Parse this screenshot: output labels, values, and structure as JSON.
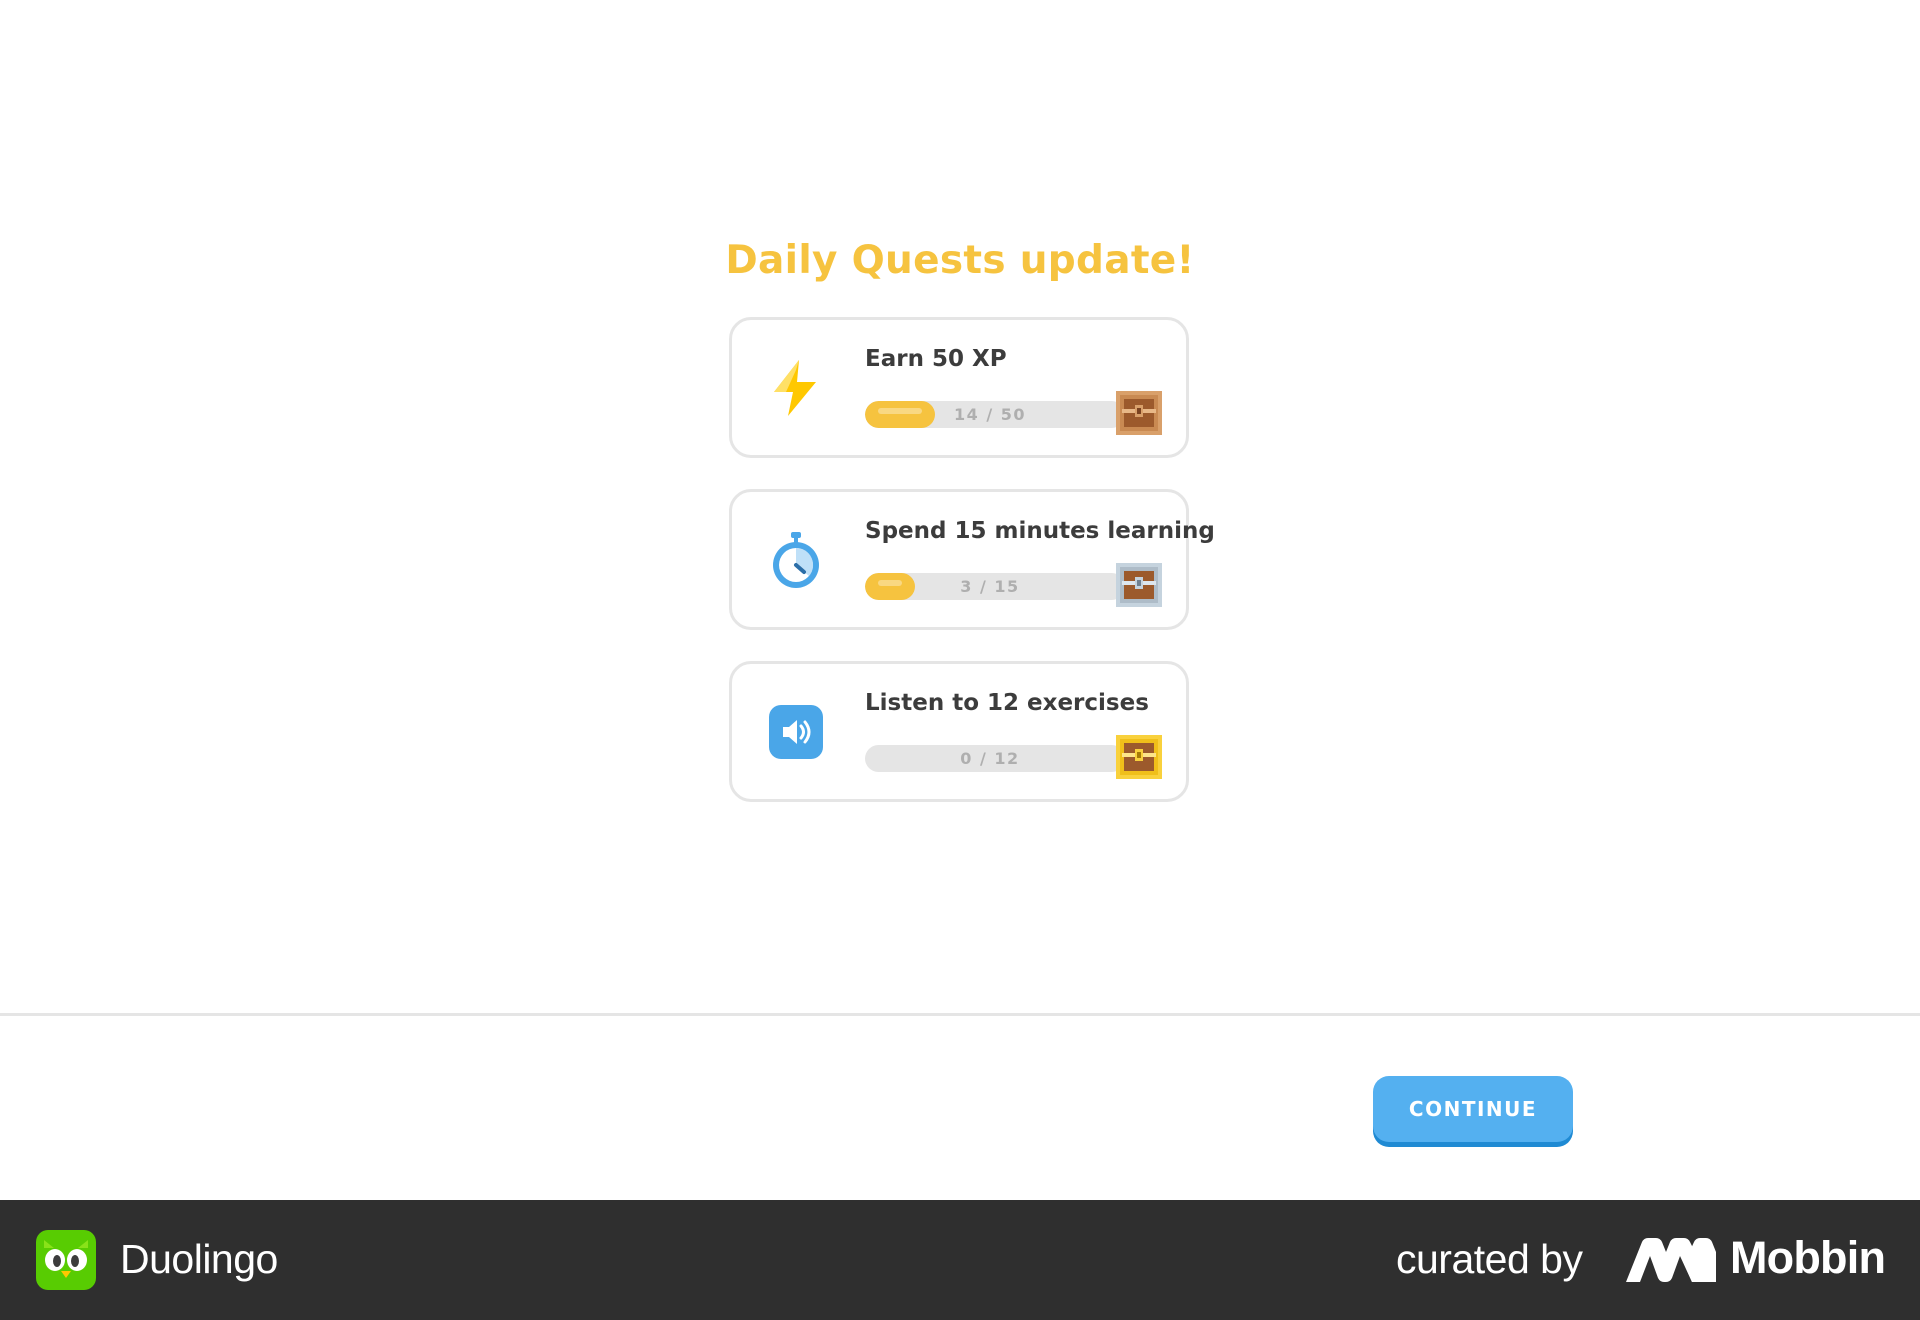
{
  "header": {
    "title": "Daily Quests update!"
  },
  "quests": [
    {
      "title": "Earn 50 XP",
      "icon": "lightning-bolt-icon",
      "current": 14,
      "target": 50,
      "progress_text": "14 / 50",
      "reward": "wooden-chest-icon"
    },
    {
      "title": "Spend 15 minutes learning",
      "icon": "stopwatch-icon",
      "current": 3,
      "target": 15,
      "progress_text": "3 / 15",
      "reward": "silver-chest-icon"
    },
    {
      "title": "Listen to 12 exercises",
      "icon": "speaker-icon",
      "current": 0,
      "target": 12,
      "progress_text": "0 / 12",
      "reward": "gold-chest-icon"
    }
  ],
  "actions": {
    "continue_label": "CONTINUE"
  },
  "footer": {
    "app_name": "Duolingo",
    "curated_label": "curated by",
    "curator_name": "Mobbin"
  },
  "colors": {
    "title_yellow": "#f6c33f",
    "progress_fill": "#f6c33f",
    "progress_track": "#e5e5e5",
    "button_blue": "#54b0f0",
    "button_shadow": "#1f8ad3",
    "footer_bg": "#2f2f2f"
  }
}
